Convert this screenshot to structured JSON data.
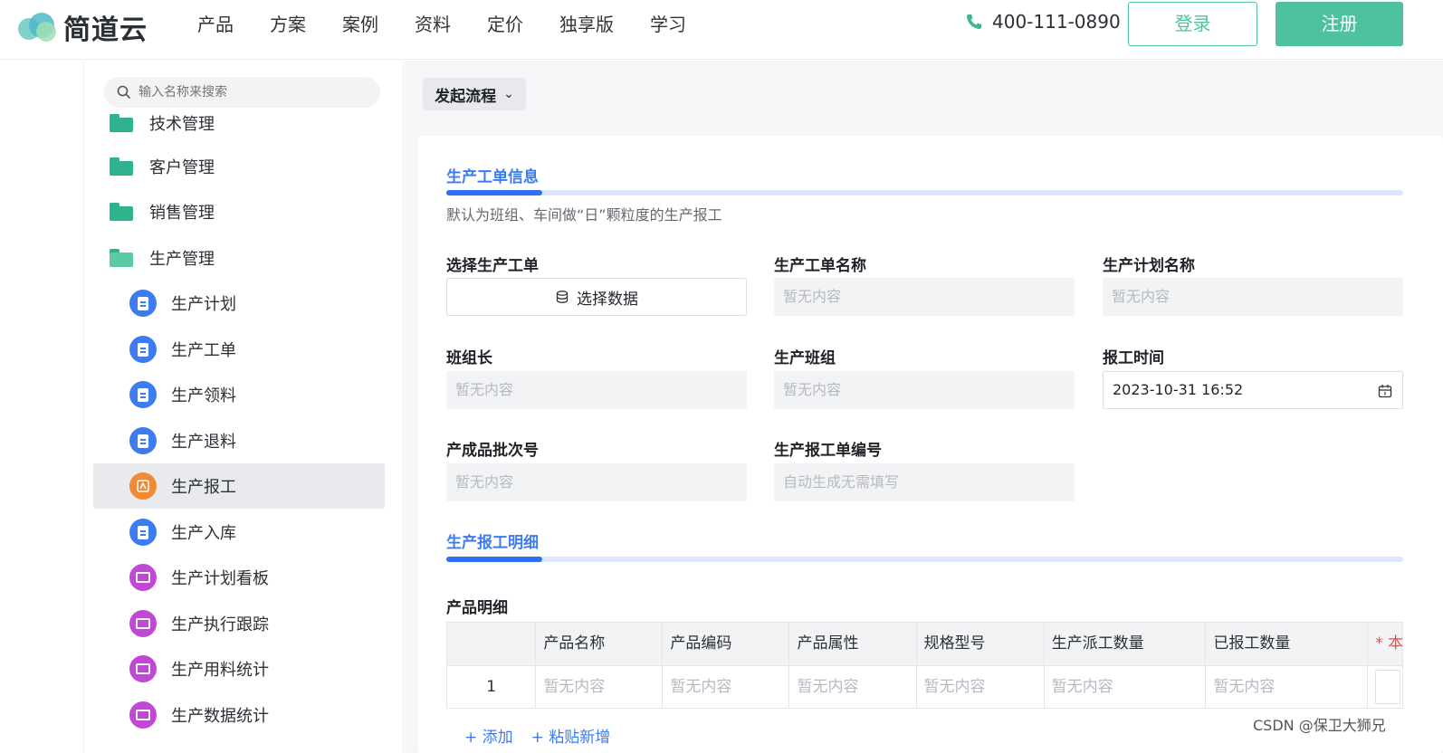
{
  "header": {
    "brand": "简道云",
    "nav": [
      "产品",
      "方案",
      "案例",
      "资料",
      "定价",
      "独享版",
      "学习"
    ],
    "phone": "400-111-0890",
    "login": "登录",
    "register": "注册",
    "accent": "#4ec1a0"
  },
  "sidebar": {
    "search_placeholder": "输入名称来搜索",
    "partial_item": "技术管理",
    "folders": [
      "客户管理",
      "销售管理",
      "生产管理"
    ],
    "items": [
      {
        "label": "生产计划",
        "icon": "form-icon",
        "color": "#3d7bf0"
      },
      {
        "label": "生产工单",
        "icon": "form-icon",
        "color": "#3d7bf0"
      },
      {
        "label": "生产领料",
        "icon": "form-icon",
        "color": "#3d7bf0"
      },
      {
        "label": "生产退料",
        "icon": "form-icon",
        "color": "#3d7bf0"
      },
      {
        "label": "生产报工",
        "icon": "flow-icon",
        "color": "#f08a35",
        "active": true
      },
      {
        "label": "生产入库",
        "icon": "form-icon",
        "color": "#3d7bf0"
      },
      {
        "label": "生产计划看板",
        "icon": "dashboard-icon",
        "color": "#c148d4"
      },
      {
        "label": "生产执行跟踪",
        "icon": "dashboard-icon",
        "color": "#c148d4"
      },
      {
        "label": "生产用料统计",
        "icon": "dashboard-icon",
        "color": "#c148d4"
      },
      {
        "label": "生产数据统计",
        "icon": "dashboard-icon",
        "color": "#c148d4"
      }
    ]
  },
  "toolbar": {
    "start_flow": "发起流程"
  },
  "form": {
    "section1": {
      "title": "生产工单信息",
      "description": "默认为班组、车间做“日”颗粒度的生产报工"
    },
    "fields": {
      "select_order_label": "选择生产工单",
      "select_data_button": "选择数据",
      "order_name_label": "生产工单名称",
      "order_name_value": "暂无内容",
      "plan_name_label": "生产计划名称",
      "plan_name_value": "暂无内容",
      "leader_label": "班组长",
      "leader_value": "暂无内容",
      "team_label": "生产班组",
      "team_value": "暂无内容",
      "report_time_label": "报工时间",
      "report_time_value": "2023-10-31 16:52",
      "batch_label": "产成品批次号",
      "batch_value": "暂无内容",
      "report_no_label": "生产报工单编号",
      "report_no_value": "自动生成无需填写"
    },
    "section2": {
      "title": "生产报工明细"
    },
    "detail": {
      "title": "产品明细",
      "columns": [
        "产品名称",
        "产品编码",
        "产品属性",
        "规格型号",
        "生产派工数量",
        "已报工数量",
        "* 本"
      ],
      "rows": [
        {
          "index": "1",
          "cells": [
            "暂无内容",
            "暂无内容",
            "暂无内容",
            "暂无内容",
            "暂无内容",
            "暂无内容",
            ""
          ]
        }
      ],
      "add": "+ 添加",
      "paste_add": "+ 粘贴新增"
    }
  },
  "watermark": "CSDN @保卫大狮兄"
}
